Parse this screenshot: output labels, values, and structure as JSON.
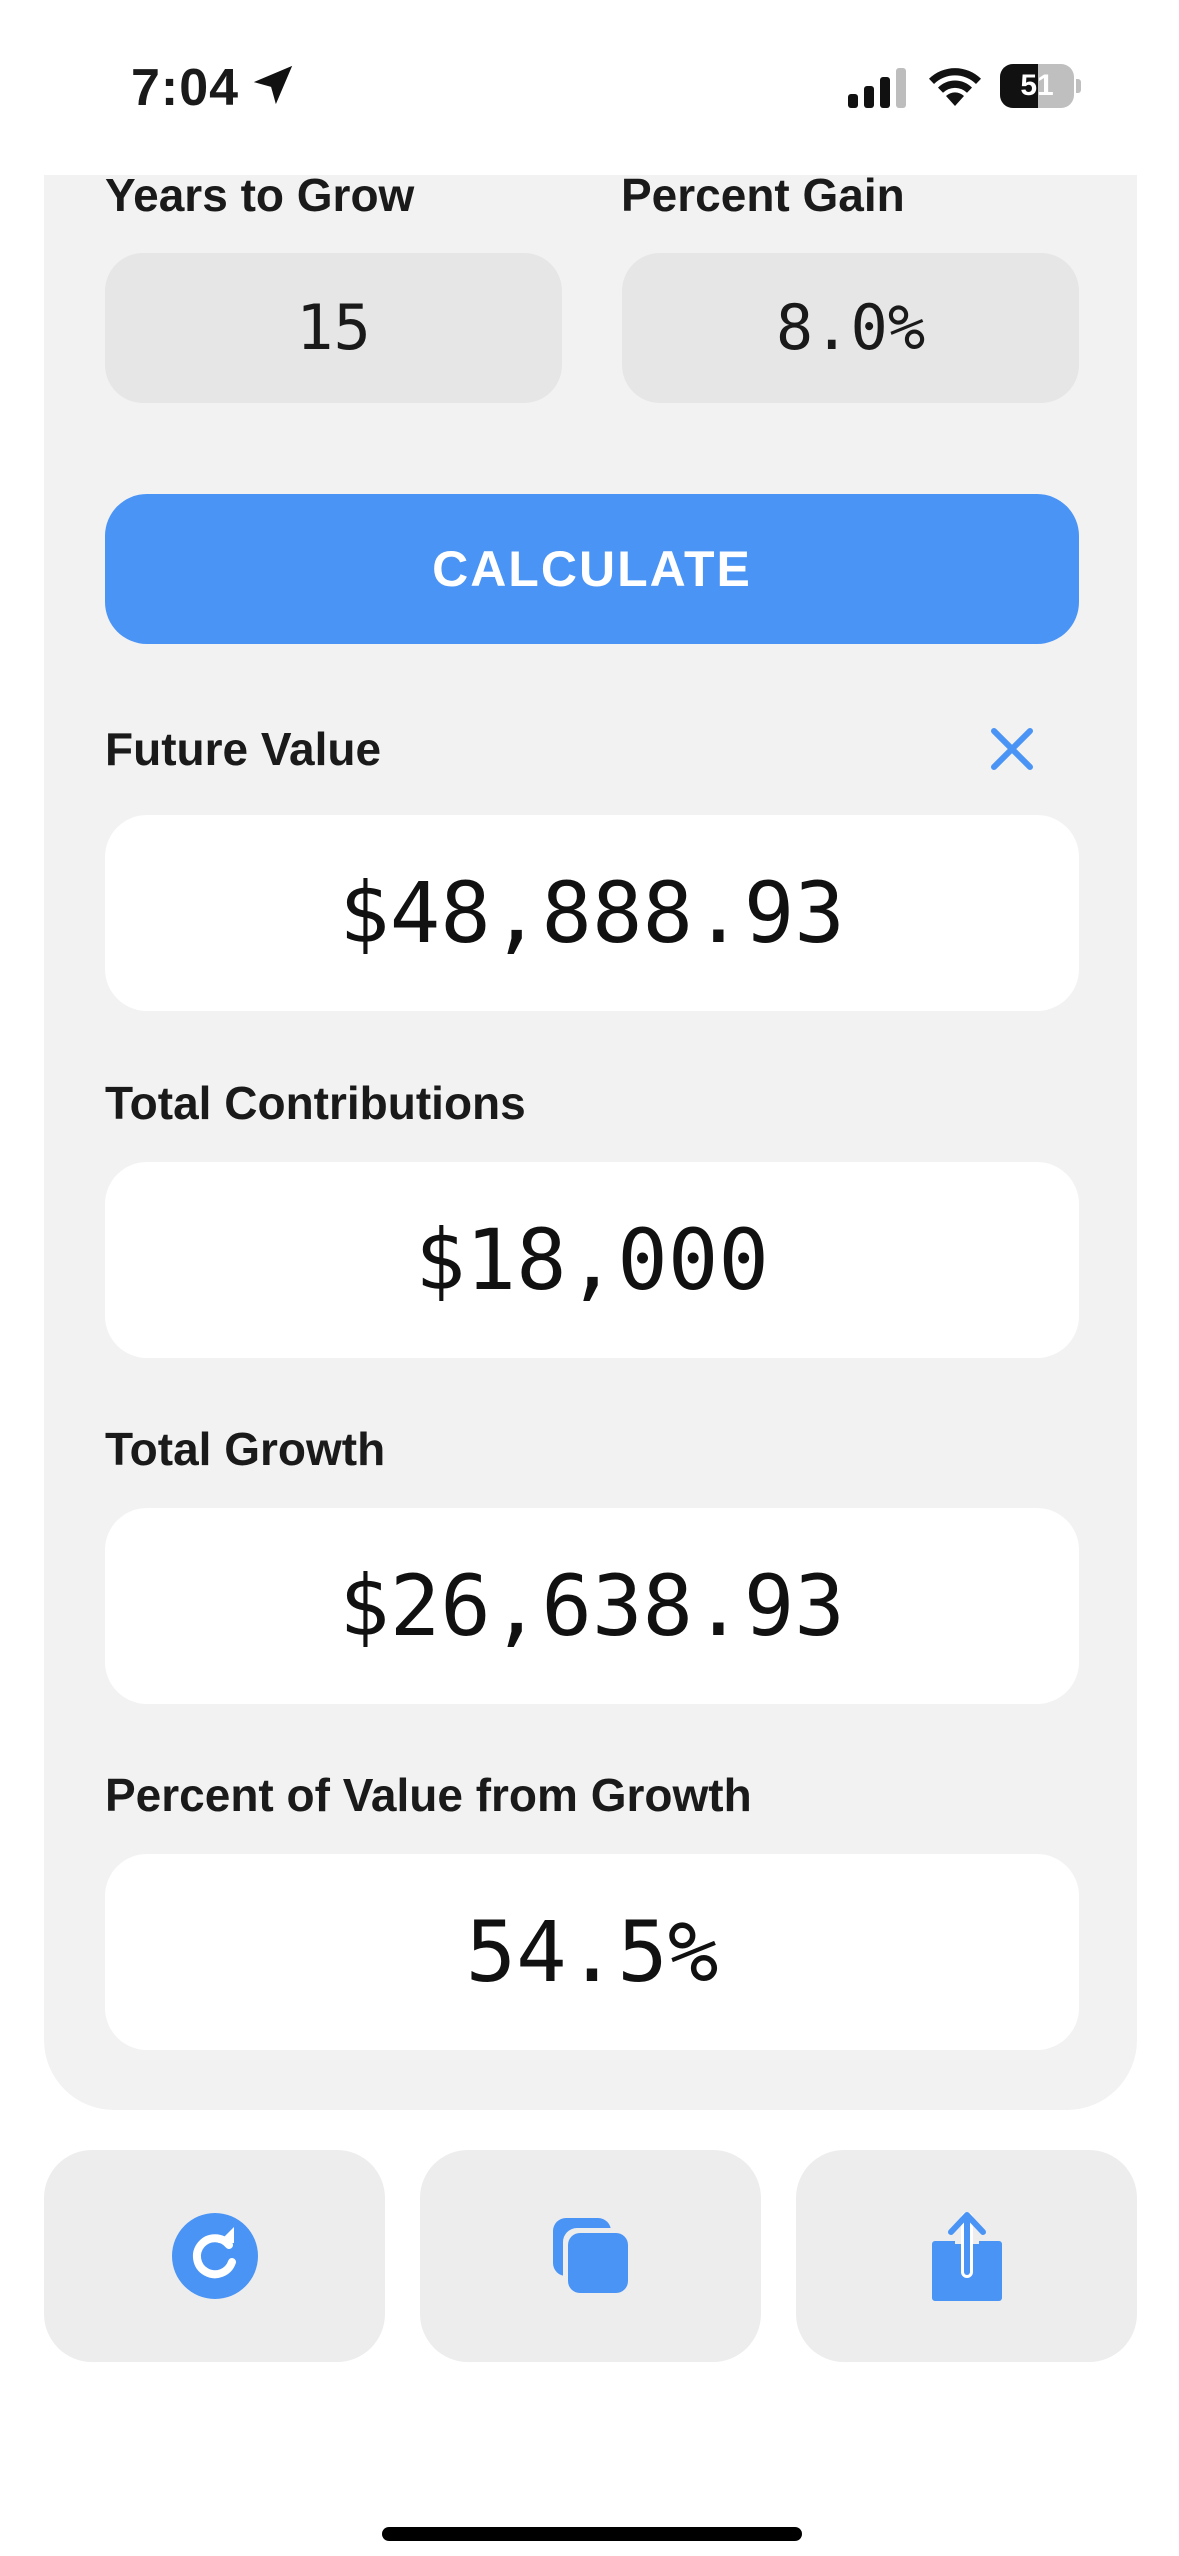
{
  "status_bar": {
    "time": "7:04",
    "battery": "51",
    "battery_fraction": 0.51
  },
  "inputs": {
    "years_label": "Years to Grow",
    "years_value": "15",
    "percent_label": "Percent Gain",
    "percent_value": "8.0%"
  },
  "calculate_label": "CALCULATE",
  "results": [
    {
      "label": "Future Value",
      "value": "$48,888.93"
    },
    {
      "label": "Total Contributions",
      "value": "$18,000"
    },
    {
      "label": "Total Growth",
      "value": "$26,638.93"
    },
    {
      "label": "Percent of Value from Growth",
      "value": "54.5%"
    }
  ],
  "icons": {
    "clear": "close-icon",
    "reset": "refresh-icon",
    "copy": "copy-icon",
    "share": "share-icon"
  },
  "colors": {
    "accent": "#4a94f5",
    "card_background": "#f2f2f2",
    "input_background": "#e6e6e6",
    "result_background": "#ffffff"
  }
}
